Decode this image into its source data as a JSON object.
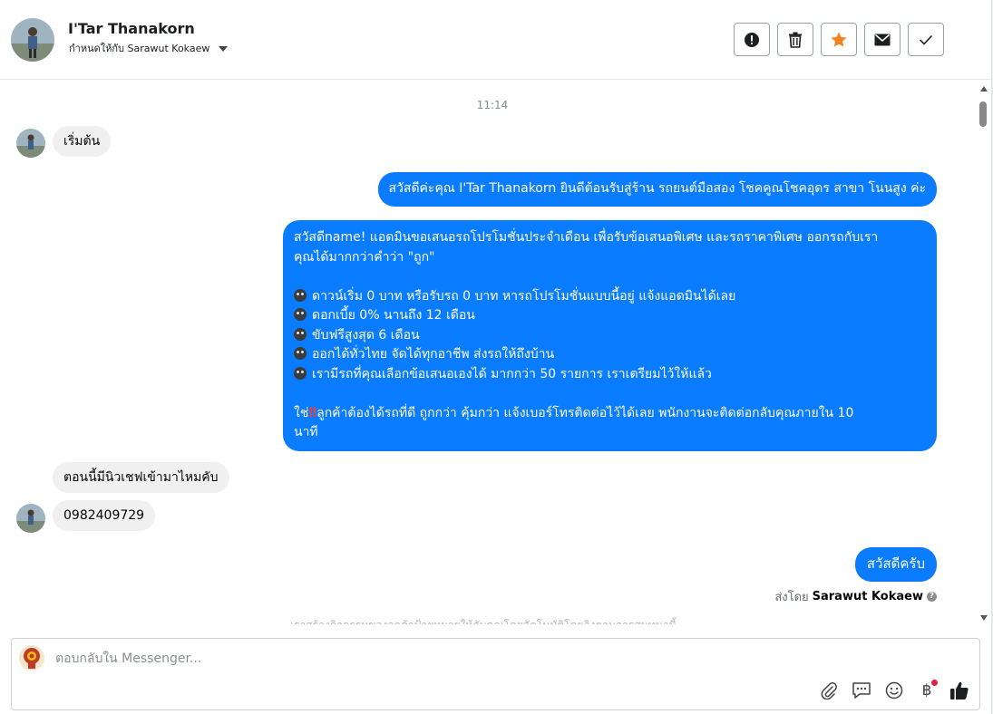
{
  "header": {
    "name": "I'Tar Thanakorn",
    "assigned_to": "กำหนดให้กับ Sarawut Kokaew",
    "actions": [
      {
        "name": "mark-spam",
        "icon": "alert-circle-icon"
      },
      {
        "name": "delete",
        "icon": "trash-icon"
      },
      {
        "name": "star",
        "icon": "star-icon",
        "color": "#f5821f"
      },
      {
        "name": "mark-unread",
        "icon": "envelope-icon"
      },
      {
        "name": "mark-done",
        "icon": "check-icon"
      }
    ]
  },
  "thread": {
    "timestamp": "11:14",
    "messages": {
      "start": "เริ่มต้น",
      "welcome": "สวัสดีค่ะคุณ I'Tar Thanakorn ยินดีต้อนรับสู่ร้าน รถยนต์มือสอง โชคคูณโชคอุดร สาขา โนนสูง ค่ะ",
      "promo": {
        "line1": "สวัสดีname! แอดมินขอเสนอรถโปรโมชั่นประจำเดือน เพื่อรับข้อเสนอพิเศษ และรถราคาพิเศษ ออกรถกับเรา",
        "line2": "คุณได้มากกว่าคำว่า \"ถูก\"",
        "bullets": [
          "ดาวน์เริ่ม 0 บาท หรือรับรถ 0 บาท หารถโปรโมชั่นแบบนี้อยู่ แจ้งแอดมินได้เลย",
          "ดอกเบี้ย 0% นานถึง 12 เดือน",
          "ขับฟรีสูงสุด 6 เดือน",
          "ออกได้ทั่วไทย จัดได้ทุกอาชีพ ส่งรถให้ถึงบ้าน",
          "เรามีรถที่คุณเลือกข้อเสนอเองได้ มากกว่า 50 รายการ เราเตรียมไว้ให้แล้ว"
        ],
        "closing_prefix": "ใช่",
        "closing_mark": "‼",
        "closing_line1": "ลูกค้าต้องได้รถที่ดี ถูกกว่า คุ้มกว่า แจ้งเบอร์โทรติดต่อไว้ได้เลย พนักงานจะติดต่อกลับคุณภายใน 10",
        "closing_line2": "นาที"
      },
      "ask_news": "ตอนนี้มีนิวเชฟเข้ามาไหมคับ",
      "phone": "0982409729",
      "reply": "สวัสดีครับ"
    },
    "sent_by_label": "ส่งโดย",
    "sent_by_name": "Sarawut Kokaew",
    "faded_note": "เราสร้างกิจกรรมของลูกค้าป้ายหมายให้กับคุณโดยอัตโนมัติโดยอิงตามการสนทนานี้"
  },
  "composer": {
    "placeholder": "ตอบกลับใน Messenger...",
    "tools": [
      "paperclip-icon",
      "saved-reply-icon",
      "emoji-icon",
      "baht-payment-icon",
      "thumbs-up-icon"
    ],
    "baht_symbol": "฿"
  },
  "colors": {
    "outgoing_bubble": "#0a7cff",
    "incoming_bubble": "#f0f0f0",
    "star": "#f5821f",
    "notification_dot": "#e41e3f"
  }
}
